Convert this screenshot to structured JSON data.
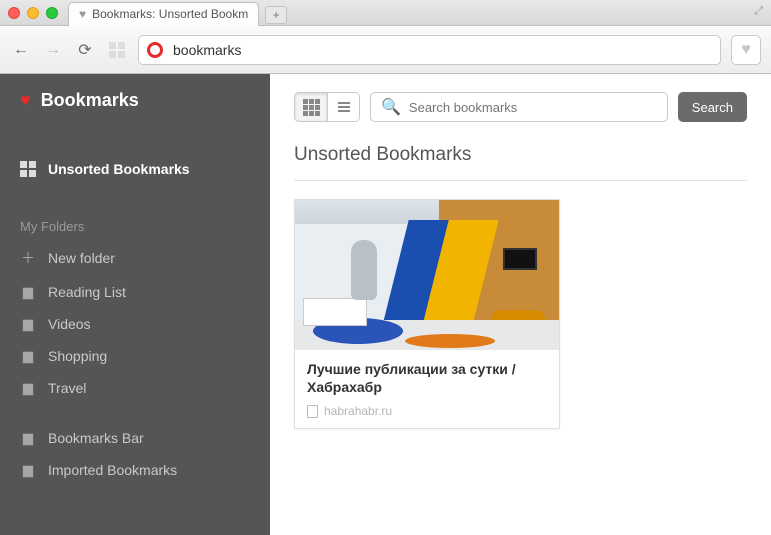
{
  "chrome": {
    "tab_title": "Bookmarks: Unsorted Bookm",
    "address": "bookmarks"
  },
  "sidebar": {
    "title": "Bookmarks",
    "active_label": "Unsorted Bookmarks",
    "my_folders_heading": "My Folders",
    "new_folder_label": "New folder",
    "folders": [
      {
        "label": "Reading List"
      },
      {
        "label": "Videos"
      },
      {
        "label": "Shopping"
      },
      {
        "label": "Travel"
      }
    ],
    "system_folders": [
      {
        "label": "Bookmarks Bar"
      },
      {
        "label": "Imported Bookmarks"
      }
    ]
  },
  "main": {
    "search_placeholder": "Search bookmarks",
    "search_button": "Search",
    "heading": "Unsorted Bookmarks",
    "cards": [
      {
        "title": "Лучшие публикации за сутки / Хабрахабр",
        "domain": "habrahabr.ru"
      }
    ]
  }
}
